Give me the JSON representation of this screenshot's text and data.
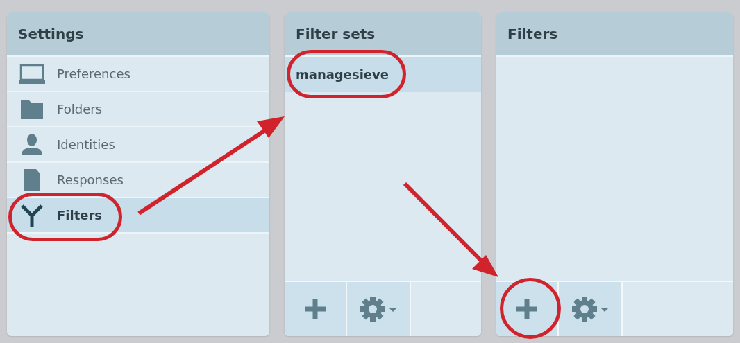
{
  "settings": {
    "title": "Settings",
    "items": [
      {
        "kind": "preferences",
        "label": "Preferences",
        "selected": false
      },
      {
        "kind": "folders",
        "label": "Folders",
        "selected": false
      },
      {
        "kind": "identities",
        "label": "Identities",
        "selected": false
      },
      {
        "kind": "responses",
        "label": "Responses",
        "selected": false
      },
      {
        "kind": "filters",
        "label": "Filters",
        "selected": true
      }
    ]
  },
  "filter_sets": {
    "title": "Filter sets",
    "items": [
      {
        "label": "managesieve",
        "selected": true
      }
    ]
  },
  "filters": {
    "title": "Filters"
  }
}
